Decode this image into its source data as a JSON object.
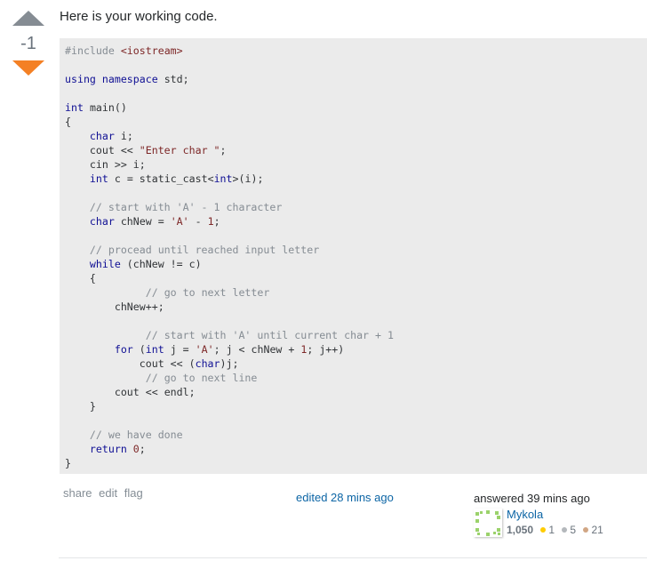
{
  "vote": {
    "up_icon": "triangle-up-icon",
    "count": "-1",
    "down_icon": "triangle-down-icon",
    "down_color": "#f48024",
    "up_color": "#858c93"
  },
  "post": {
    "intro": "Here is your working code.",
    "code_lines": [
      "#include <iostream>",
      "",
      "using namespace std;",
      "",
      "int main()",
      "{",
      "    char i;",
      "    cout << \"Enter char \";",
      "    cin >> i;",
      "    int c = static_cast<int>(i);",
      "",
      "    // start with 'A' - 1 character",
      "    char chNew = 'A' - 1;",
      "",
      "    // procead until reached input letter",
      "    while (chNew != c)",
      "    {",
      "             // go to next letter",
      "        chNew++;",
      "",
      "             // start with 'A' until current char + 1",
      "        for (int j = 'A'; j < chNew + 1; j++)",
      "            cout << (char)j;",
      "             // go to next line",
      "        cout << endl;",
      "    }",
      "",
      "    // we have done",
      "    return 0;",
      "}"
    ]
  },
  "menu": {
    "share": "share",
    "edit": "edit",
    "flag": "flag"
  },
  "edited": "edited 28 mins ago",
  "owner": {
    "action": "answered 39 mins ago",
    "avatar_icon": "identicon-avatar",
    "name": "Mykola",
    "reputation": "1,050",
    "gold": "1",
    "silver": "5",
    "bronze": "21",
    "gold_color": "#ffcc01",
    "silver_color": "#b4b8bc",
    "bronze_color": "#d1a684"
  }
}
